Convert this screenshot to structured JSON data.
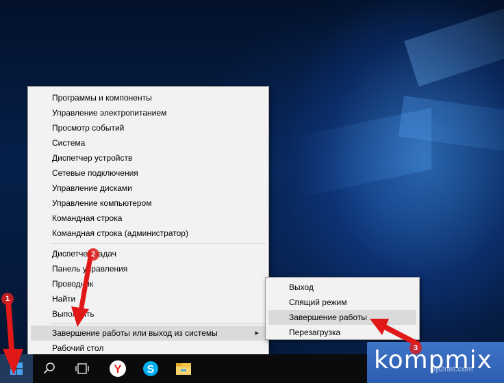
{
  "context_menu": {
    "items": [
      {
        "label": "Программы и компоненты"
      },
      {
        "label": "Управление электропитанием"
      },
      {
        "label": "Просмотр событий"
      },
      {
        "label": "Система"
      },
      {
        "label": "Диспетчер устройств"
      },
      {
        "label": "Сетевые подключения"
      },
      {
        "label": "Управление дисками"
      },
      {
        "label": "Управление компьютером"
      },
      {
        "label": "Командная строка"
      },
      {
        "label": "Командная строка (администратор)"
      },
      {
        "label": "Диспетчер задач"
      },
      {
        "label": "Панель управления"
      },
      {
        "label": "Проводник"
      },
      {
        "label": "Найти"
      },
      {
        "label": "Выполнить"
      },
      {
        "label": "Завершение работы или выход из системы"
      },
      {
        "label": "Рабочий стол"
      }
    ],
    "selected_item": "Завершение работы или выход из системы"
  },
  "submenu": {
    "items": [
      {
        "label": "Выход"
      },
      {
        "label": "Спящий режим"
      },
      {
        "label": "Завершение работы"
      },
      {
        "label": "Перезагрузка"
      }
    ],
    "selected_item": "Завершение работы"
  },
  "taskbar": {
    "buttons": [
      "windows-start-icon",
      "search-icon",
      "task-view-icon",
      "yandex-browser-icon",
      "skype-icon",
      "file-explorer-icon"
    ]
  },
  "annotations": {
    "step_1": "1",
    "step_2": "2",
    "step_3": "3",
    "arrow_color": "#e01818"
  },
  "watermark": {
    "brand": "kompmix",
    "sub": "Up2net.com"
  },
  "colors": {
    "menu_bg": "#f2f2f2",
    "selection": "#dadada",
    "taskbar": "#0b0b0d",
    "start_highlight": "#213a5c",
    "brand_bg": "#3e74c6"
  }
}
